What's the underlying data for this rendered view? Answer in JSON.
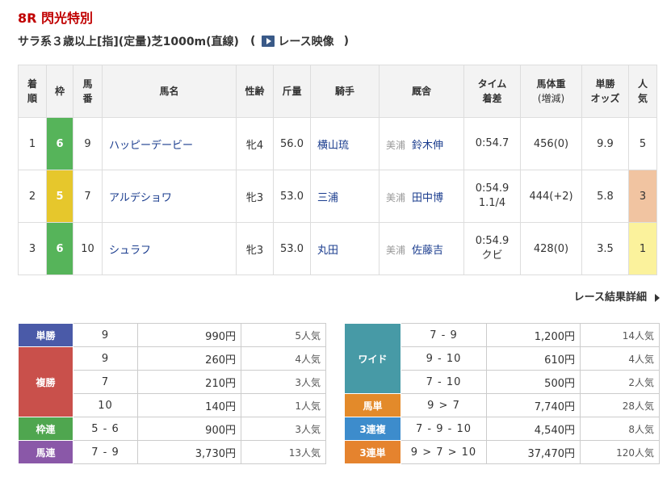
{
  "race": {
    "title": "8R 閃光特別",
    "conditions": "サラ系３歳以上[指](定量)芝1000m(直線)",
    "open_paren": "(",
    "video_label": "レース映像",
    "close_paren": ")"
  },
  "results_table": {
    "headers": {
      "rank": [
        "着",
        "順"
      ],
      "waku": "枠",
      "umaban": [
        "馬",
        "番"
      ],
      "horse": "馬名",
      "sexage": "性齢",
      "weight": "斤量",
      "jockey": "騎手",
      "stable": "厩舎",
      "time": [
        "タイム",
        "着差"
      ],
      "bodyweight": [
        "馬体重",
        "(増減)"
      ],
      "odds": [
        "単勝",
        "オッズ"
      ],
      "ninki": [
        "人",
        "気"
      ]
    },
    "rows": [
      {
        "rank": "1",
        "waku": "6",
        "umaban": "9",
        "horse": "ハッピーデービー",
        "sexage": "牝4",
        "weight": "56.0",
        "jockey": "横山琉",
        "area": "美浦",
        "trainer": "鈴木伸",
        "time": "0:54.7",
        "margin": "",
        "bodyweight": "456(0)",
        "odds": "9.9",
        "ninki": "5"
      },
      {
        "rank": "2",
        "waku": "5",
        "umaban": "7",
        "horse": "アルデショワ",
        "sexage": "牝3",
        "weight": "53.0",
        "jockey": "三浦",
        "area": "美浦",
        "trainer": "田中博",
        "time": "0:54.9",
        "margin": "1.1/4",
        "bodyweight": "444(+2)",
        "odds": "5.8",
        "ninki": "3"
      },
      {
        "rank": "3",
        "waku": "6",
        "umaban": "10",
        "horse": "シュラフ",
        "sexage": "牝3",
        "weight": "53.0",
        "jockey": "丸田",
        "area": "美浦",
        "trainer": "佐藤吉",
        "time": "0:54.9",
        "margin": "クビ",
        "bodyweight": "428(0)",
        "odds": "3.5",
        "ninki": "1"
      }
    ]
  },
  "detail_link": "レース結果詳細",
  "payouts_left": {
    "tansho": {
      "label": "単勝",
      "rows": [
        {
          "num": "9",
          "amount": "990円",
          "pop": "5人気"
        }
      ]
    },
    "fukusho": {
      "label": "複勝",
      "rows": [
        {
          "num": "9",
          "amount": "260円",
          "pop": "4人気"
        },
        {
          "num": "7",
          "amount": "210円",
          "pop": "3人気"
        },
        {
          "num": "10",
          "amount": "140円",
          "pop": "1人気"
        }
      ]
    },
    "wakuren": {
      "label": "枠連",
      "rows": [
        {
          "num": "5 - 6",
          "amount": "900円",
          "pop": "3人気"
        }
      ]
    },
    "umaren": {
      "label": "馬連",
      "rows": [
        {
          "num": "7 - 9",
          "amount": "3,730円",
          "pop": "13人気"
        }
      ]
    }
  },
  "payouts_right": {
    "wide": {
      "label": "ワイド",
      "rows": [
        {
          "num": "7 - 9",
          "amount": "1,200円",
          "pop": "14人気"
        },
        {
          "num": "9 - 10",
          "amount": "610円",
          "pop": "4人気"
        },
        {
          "num": "7 - 10",
          "amount": "500円",
          "pop": "2人気"
        }
      ]
    },
    "umatan": {
      "label": "馬単",
      "rows": [
        {
          "num": "9 > 7",
          "amount": "7,740円",
          "pop": "28人気"
        }
      ]
    },
    "sanrenpuku": {
      "label": "3連複",
      "rows": [
        {
          "num": "7 - 9 - 10",
          "amount": "4,540円",
          "pop": "8人気"
        }
      ]
    },
    "sanrentan": {
      "label": "3連単",
      "rows": [
        {
          "num": "9 > 7 > 10",
          "amount": "37,470円",
          "pop": "120人気"
        }
      ]
    }
  },
  "colors": {
    "title_red": "#c00000",
    "waku_6": "#56b45a",
    "waku_5": "#e6c72c",
    "link_blue": "#1a3c8e",
    "tansho": "#4a5aa8",
    "fukusho": "#c9504b",
    "wakuren": "#4fa64f",
    "umaren": "#8a58a8",
    "wide": "#479aa6",
    "umatan": "#e38a2a",
    "sanrenpuku": "#3d8ccc",
    "sanrentan": "#e5832e"
  },
  "icons": {
    "video": "video-play-icon",
    "detail_arrow": "triangle-right-icon"
  }
}
